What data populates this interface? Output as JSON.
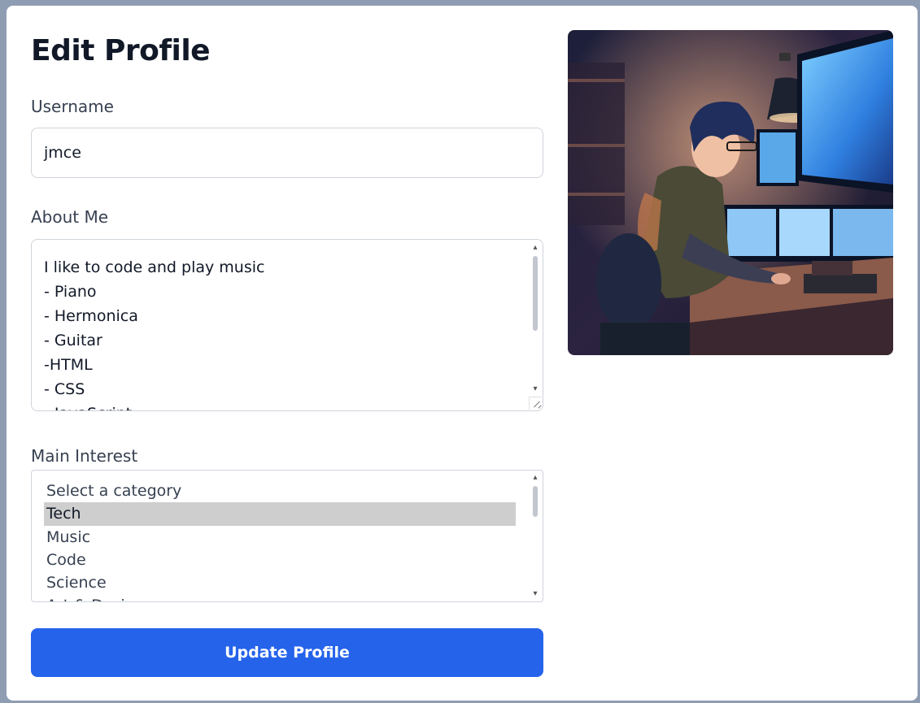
{
  "form": {
    "title": "Edit Profile",
    "username_label": "Username",
    "username_value": "jmce",
    "about_label": "About Me",
    "about_value": "I like to code and play music\n- Piano\n- Hermonica\n- Guitar\n-HTML\n- CSS\n- JavaScript",
    "interest_label": "Main Interest",
    "interest_options": [
      {
        "label": "Select a category",
        "selected": false
      },
      {
        "label": "Tech",
        "selected": true
      },
      {
        "label": "Music",
        "selected": false
      },
      {
        "label": "Code",
        "selected": false
      },
      {
        "label": "Science",
        "selected": false
      },
      {
        "label": "Art & Design",
        "selected": false
      }
    ],
    "submit_label": "Update Profile"
  },
  "colors": {
    "primary_button": "#2563eb",
    "page_background": "#8f9db3",
    "selected_option": "#cecece"
  },
  "image": {
    "description_icon": "profile-photo"
  }
}
